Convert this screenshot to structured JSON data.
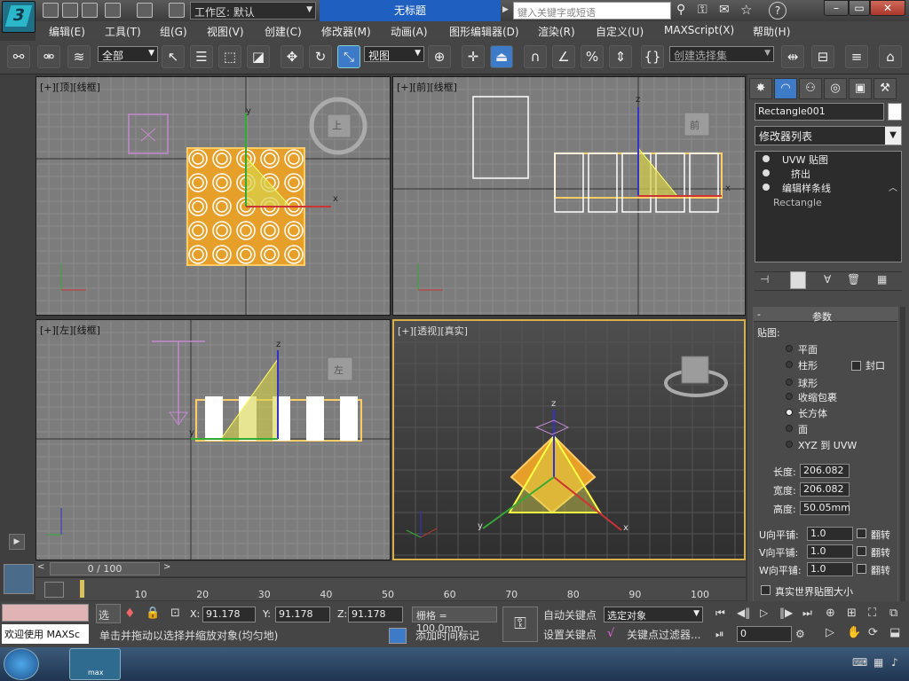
{
  "window": {
    "workspace": "工作区: 默认",
    "title": "无标题",
    "search_placeholder": "键入关键字或短语"
  },
  "menu": [
    "编辑(E)",
    "工具(T)",
    "组(G)",
    "视图(V)",
    "创建(C)",
    "修改器(M)",
    "动画(A)",
    "图形编辑器(D)",
    "渲染(R)",
    "自定义(U)",
    "MAXScript(X)",
    "帮助(H)"
  ],
  "toolbar": {
    "filter_value": "全部",
    "coord_value": "视图",
    "selection_set_placeholder": "创建选择集"
  },
  "viewports": {
    "top": "[+][顶][线框]",
    "front": "[+][前][线框]",
    "left": "[+][左][线框]",
    "persp": "[+][透视][真实]",
    "cube_top": "上",
    "cube_front": "前",
    "cube_left": "左",
    "axis_x": "x",
    "axis_y": "y",
    "axis_z": "z"
  },
  "command_panel": {
    "object_name": "Rectangle001",
    "modifier_list": "修改器列表",
    "stack": [
      "UVW 贴图",
      "挤出",
      "编辑样条线",
      "Rectangle"
    ],
    "rollout_title": "参数",
    "mapping_label": "贴图:",
    "mapping_options": [
      "平面",
      "柱形",
      "球形",
      "收缩包裹",
      "长方体",
      "面",
      "XYZ 到 UVW"
    ],
    "cap_label": "封口",
    "length_label": "长度:",
    "length_value": "206.082",
    "width_label": "宽度:",
    "width_value": "206.082",
    "height_label": "高度:",
    "height_value": "50.05mm",
    "u_tile_label": "U向平铺:",
    "u_tile_value": "1.0",
    "v_tile_label": "V向平铺:",
    "v_tile_value": "1.0",
    "w_tile_label": "W向平铺:",
    "w_tile_value": "1.0",
    "flip_label": "翻转",
    "realworld_label": "真实世界贴图大小"
  },
  "timeline": {
    "frame": "0 / 100",
    "ticks": [
      "0",
      "10",
      "20",
      "30",
      "40",
      "50",
      "60",
      "70",
      "80",
      "90",
      "100"
    ]
  },
  "status": {
    "welcome": "欢迎使用 MAXSc",
    "select_label": "选择",
    "prompt": "单击并拖动以选择并缩放对象(均匀地)",
    "x_label": "X:",
    "x_value": "91.178",
    "y_label": "Y:",
    "y_value": "91.178",
    "z_label": "Z:",
    "z_value": "91.178",
    "grid": "栅格 = 100.0mm",
    "add_time_tag": "添加时间标记",
    "auto_key": "自动关键点",
    "set_key": "设置关键点",
    "selected_object": "选定对象",
    "key_filters": "关键点过滤器...",
    "current_frame": "0"
  },
  "taskbar": {
    "app_label": "max"
  }
}
